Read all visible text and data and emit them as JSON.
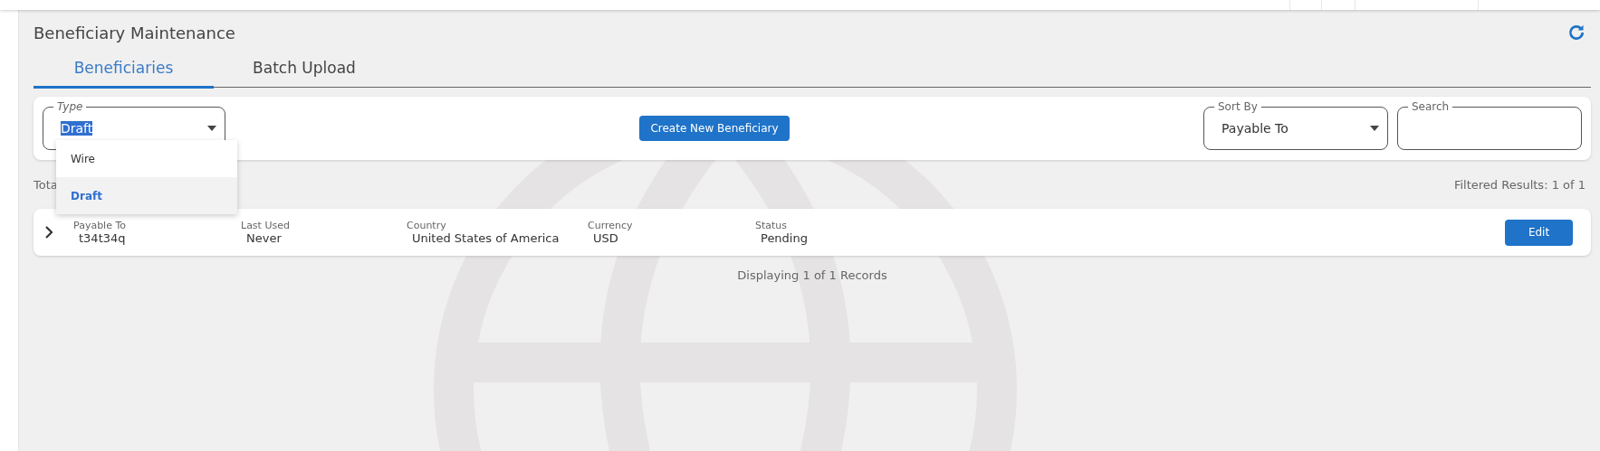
{
  "page": {
    "title": "Beneficiary Maintenance"
  },
  "tabs": [
    {
      "label": "Beneficiaries",
      "selected": true
    },
    {
      "label": "Batch Upload",
      "selected": false
    }
  ],
  "filters": {
    "type": {
      "label": "Type",
      "value": "Draft",
      "options": [
        {
          "label": "Wire",
          "selected": false
        },
        {
          "label": "Draft",
          "selected": true
        }
      ]
    },
    "create_button": "Create New Beneficiary",
    "sort_by": {
      "label": "Sort By",
      "value": "Payable To"
    },
    "search": {
      "label": "Search"
    }
  },
  "summary": {
    "total_label": "Tota",
    "filtered": "Filtered Results: 1 of 1"
  },
  "records": [
    {
      "expanded": false,
      "fields": [
        {
          "label": "Payable To",
          "value": "t34t34q"
        },
        {
          "label": "Last Used",
          "value": "Never"
        },
        {
          "label": "Country",
          "value": "United States of America"
        },
        {
          "label": "Currency",
          "value": "USD"
        },
        {
          "label": "Status",
          "value": "Pending"
        }
      ],
      "action": "Edit"
    }
  ],
  "footer": "Displaying 1 of 1 Records"
}
